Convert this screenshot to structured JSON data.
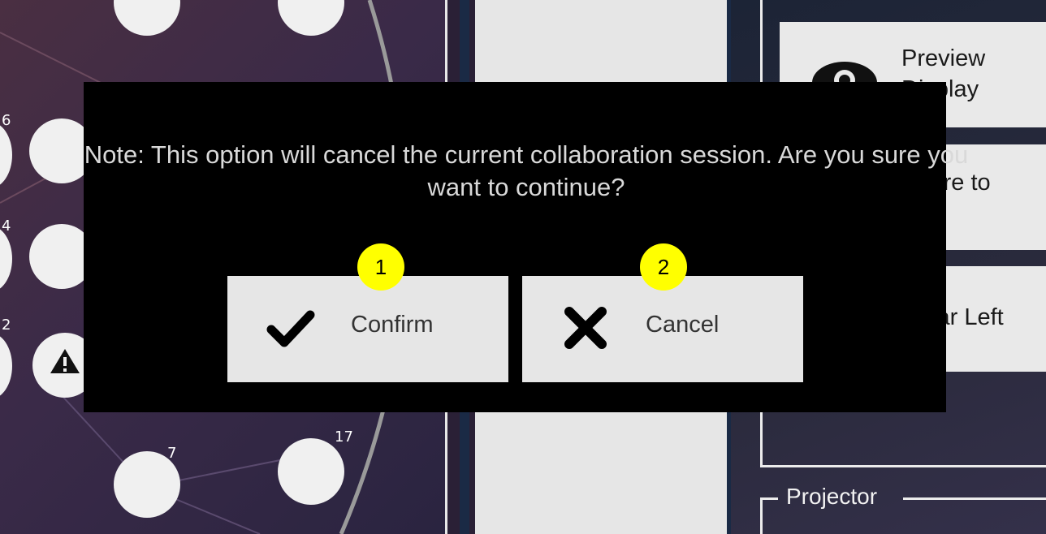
{
  "dialog": {
    "message": "Note: This option will cancel the current collaboration session. Are you sure you want to continue?",
    "confirm_label": "Confirm",
    "cancel_label": "Cancel",
    "confirm_icon": "checkmark-icon",
    "cancel_icon": "x-icon"
  },
  "callouts": {
    "confirm": "1",
    "cancel": "2"
  },
  "background": {
    "seat_numbers": [
      "6",
      "4",
      "2",
      "7",
      "17"
    ],
    "side_cards": {
      "preview": "Preview\nDisplay",
      "share": "Share to\nAll",
      "clear": "Clear Left"
    },
    "projector_label": "Projector"
  },
  "colors": {
    "modal_bg": "#000000",
    "button_bg": "#e6e6e6",
    "callout": "#ffff00",
    "message_text": "#d9d9d9"
  }
}
